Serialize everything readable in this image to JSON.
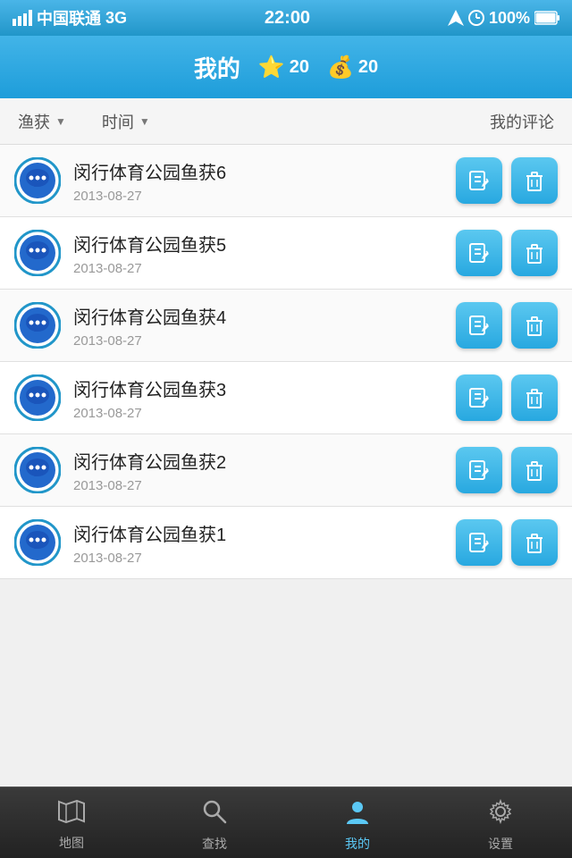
{
  "statusBar": {
    "carrier": "中国联通",
    "network": "3G",
    "time": "22:00",
    "battery": "100%"
  },
  "header": {
    "title": "我的",
    "starLabel": "20",
    "moneyLabel": "20"
  },
  "filterBar": {
    "catchLabel": "渔获",
    "timeLabel": "时间",
    "commentLabel": "我的评论"
  },
  "listItems": [
    {
      "title": "闵行体育公园鱼获6",
      "date": "2013-08-27"
    },
    {
      "title": "闵行体育公园鱼获5",
      "date": "2013-08-27"
    },
    {
      "title": "闵行体育公园鱼获4",
      "date": "2013-08-27"
    },
    {
      "title": "闵行体育公园鱼获3",
      "date": "2013-08-27"
    },
    {
      "title": "闵行体育公园鱼获2",
      "date": "2013-08-27"
    },
    {
      "title": "闵行体育公园鱼获1",
      "date": "2013-08-27"
    }
  ],
  "bottomNav": [
    {
      "label": "地图",
      "icon": "map",
      "active": false
    },
    {
      "label": "查找",
      "icon": "search",
      "active": false
    },
    {
      "label": "我的",
      "icon": "person",
      "active": true
    },
    {
      "label": "设置",
      "icon": "gear",
      "active": false
    }
  ]
}
